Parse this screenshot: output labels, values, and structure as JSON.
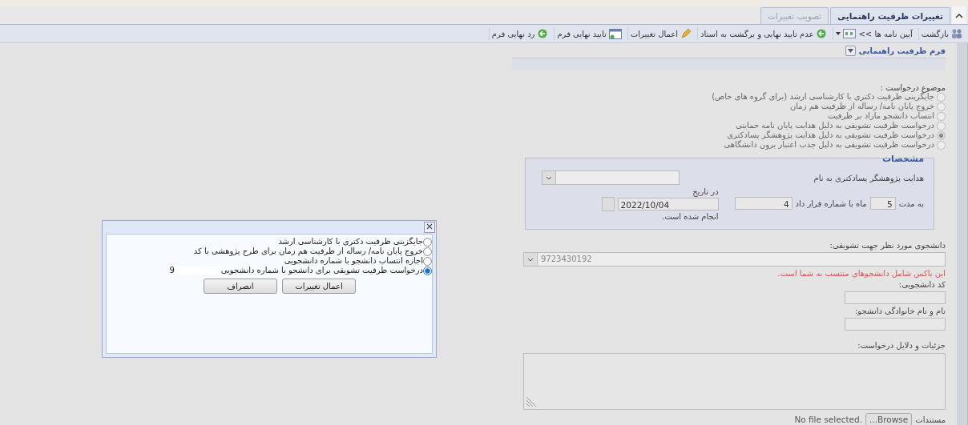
{
  "tabs": [
    {
      "label": "تغییرات ظرفیت راهنمایی",
      "selected": true
    },
    {
      "label": "تصویب تغییرات",
      "selected": false
    }
  ],
  "toolbar": [
    {
      "label": "بازگشت",
      "kind": "back"
    },
    {
      "label": "آیین نامه ها >>",
      "kind": "rules"
    },
    {
      "label": "عدم تایید نهایی و برگشت به استاد",
      "kind": "return"
    },
    {
      "label": "اعمال تغییرات",
      "kind": "apply"
    },
    {
      "label": "تایید نهایی فرم",
      "kind": "approve"
    },
    {
      "label": "رد نهایی فرم",
      "kind": "reject"
    }
  ],
  "form": {
    "legend": "فرم ظرفیت راهنمایی",
    "subject_label": "موضوع درخواست :",
    "subjects": [
      {
        "label": "جایگزینی ظرفیت دکتری با کارشناسی ارشد (برای گروه های خاص)",
        "selected": false
      },
      {
        "label": "خروج پایان نامه/ رساله از ظرفیت هم زمان",
        "selected": false
      },
      {
        "label": "انتساب دانشجو مازاد بر ظرفیت",
        "selected": false
      },
      {
        "label": "درخواست ظرفیت تشویقی به دلیل هدایت پایان نامه حمایتی",
        "selected": false
      },
      {
        "label": "درخواست ظرفیت تشویقی به دلیل هدایت پژوهشگر پسادکتری",
        "selected": true
      },
      {
        "label": "درخواست ظرفیت تشویقی به دلیل جذب اعتبار برون دانشگاهی",
        "selected": false
      }
    ],
    "details": {
      "legend": "مشخصات",
      "advisor_label": "هدایت پژوهشگر پسادکتری به نام",
      "duration_label": "به مدت",
      "months": "5",
      "contract_label": "ماه با شماره قرار داد",
      "contract": "4",
      "date_label": "در تاریخ",
      "date": "2022/10/04",
      "done": "انجام شده است."
    },
    "student_label": "دانشجوی مورد نظر جهت تشویقی:",
    "student": "9723430192",
    "student_note": "این باکس شامل دانشجوهای منتسب به شما است.",
    "code_label": "کد دانشجویی:",
    "name_label": "نام و نام خانوادگی دانشجو:",
    "reasons_label": "جزئیات و دلایل درخواست:",
    "attachments_label": "مستندات",
    "browse": "Browse...",
    "no_file": "No file selected."
  },
  "dialog": {
    "options": [
      {
        "label": "جایگزینی ظرفیت دکتری با کارشناسی ارشد",
        "selected": false
      },
      {
        "label": "خروج پایان نامه/ رساله از ظرفیت هم زمان برای طرح پژوهشی با کد",
        "selected": false
      },
      {
        "label": "اجازه انتساب دانشجو با شماره دانشجویی",
        "selected": false
      },
      {
        "label": "درخواست ظرفیت تشویقی برای دانشجو با شماره دانشجویی",
        "selected": true,
        "suffix": "9"
      }
    ],
    "buttons": [
      "اعمال تغییرات",
      "انصراف"
    ]
  }
}
